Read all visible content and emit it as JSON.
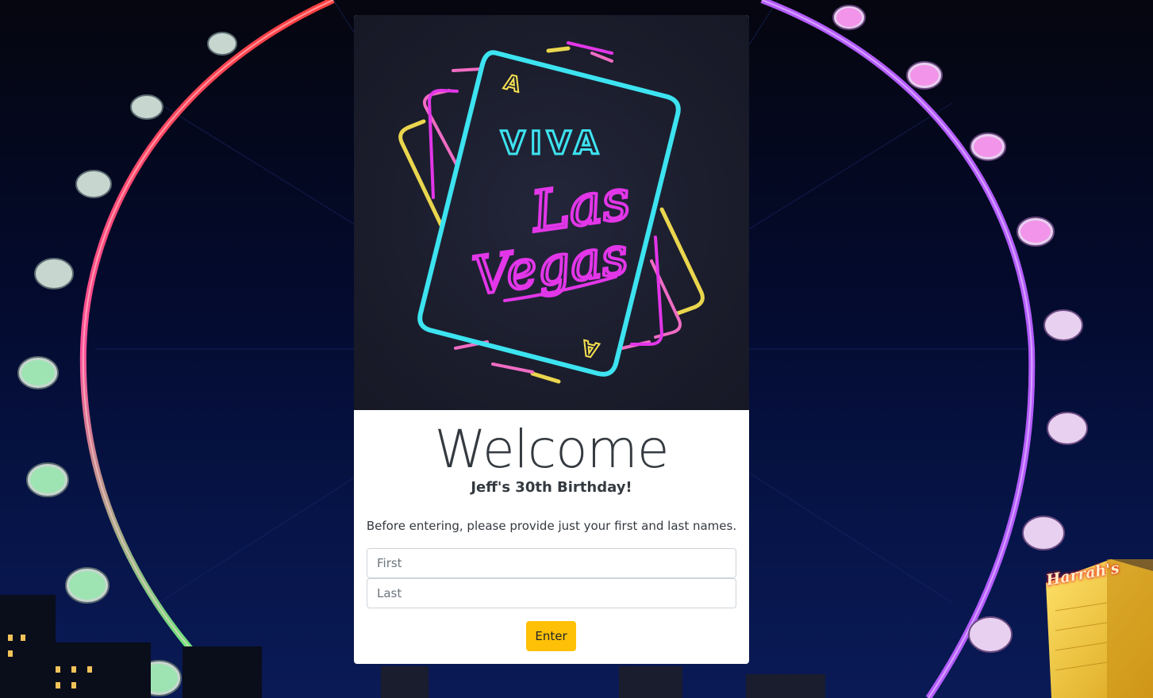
{
  "hero": {
    "viva_text": "VIVA",
    "las_text": "Las",
    "vegas_text": "Vegas",
    "card_corner": "A"
  },
  "welcome": {
    "heading": "Welcome",
    "subtitle": "Jeff's 30th Birthday!",
    "instructions": "Before entering, please provide just your first and last names."
  },
  "form": {
    "first_placeholder": "First",
    "first_value": "",
    "last_placeholder": "Last",
    "last_value": "",
    "enter_label": "Enter"
  },
  "background": {
    "sign_text": "Harrah's"
  },
  "colors": {
    "button_bg": "#ffc107",
    "neon_cyan": "#3de3f0",
    "neon_magenta": "#e236e8",
    "neon_yellow": "#f5e050",
    "neon_pink": "#f06cc4"
  }
}
